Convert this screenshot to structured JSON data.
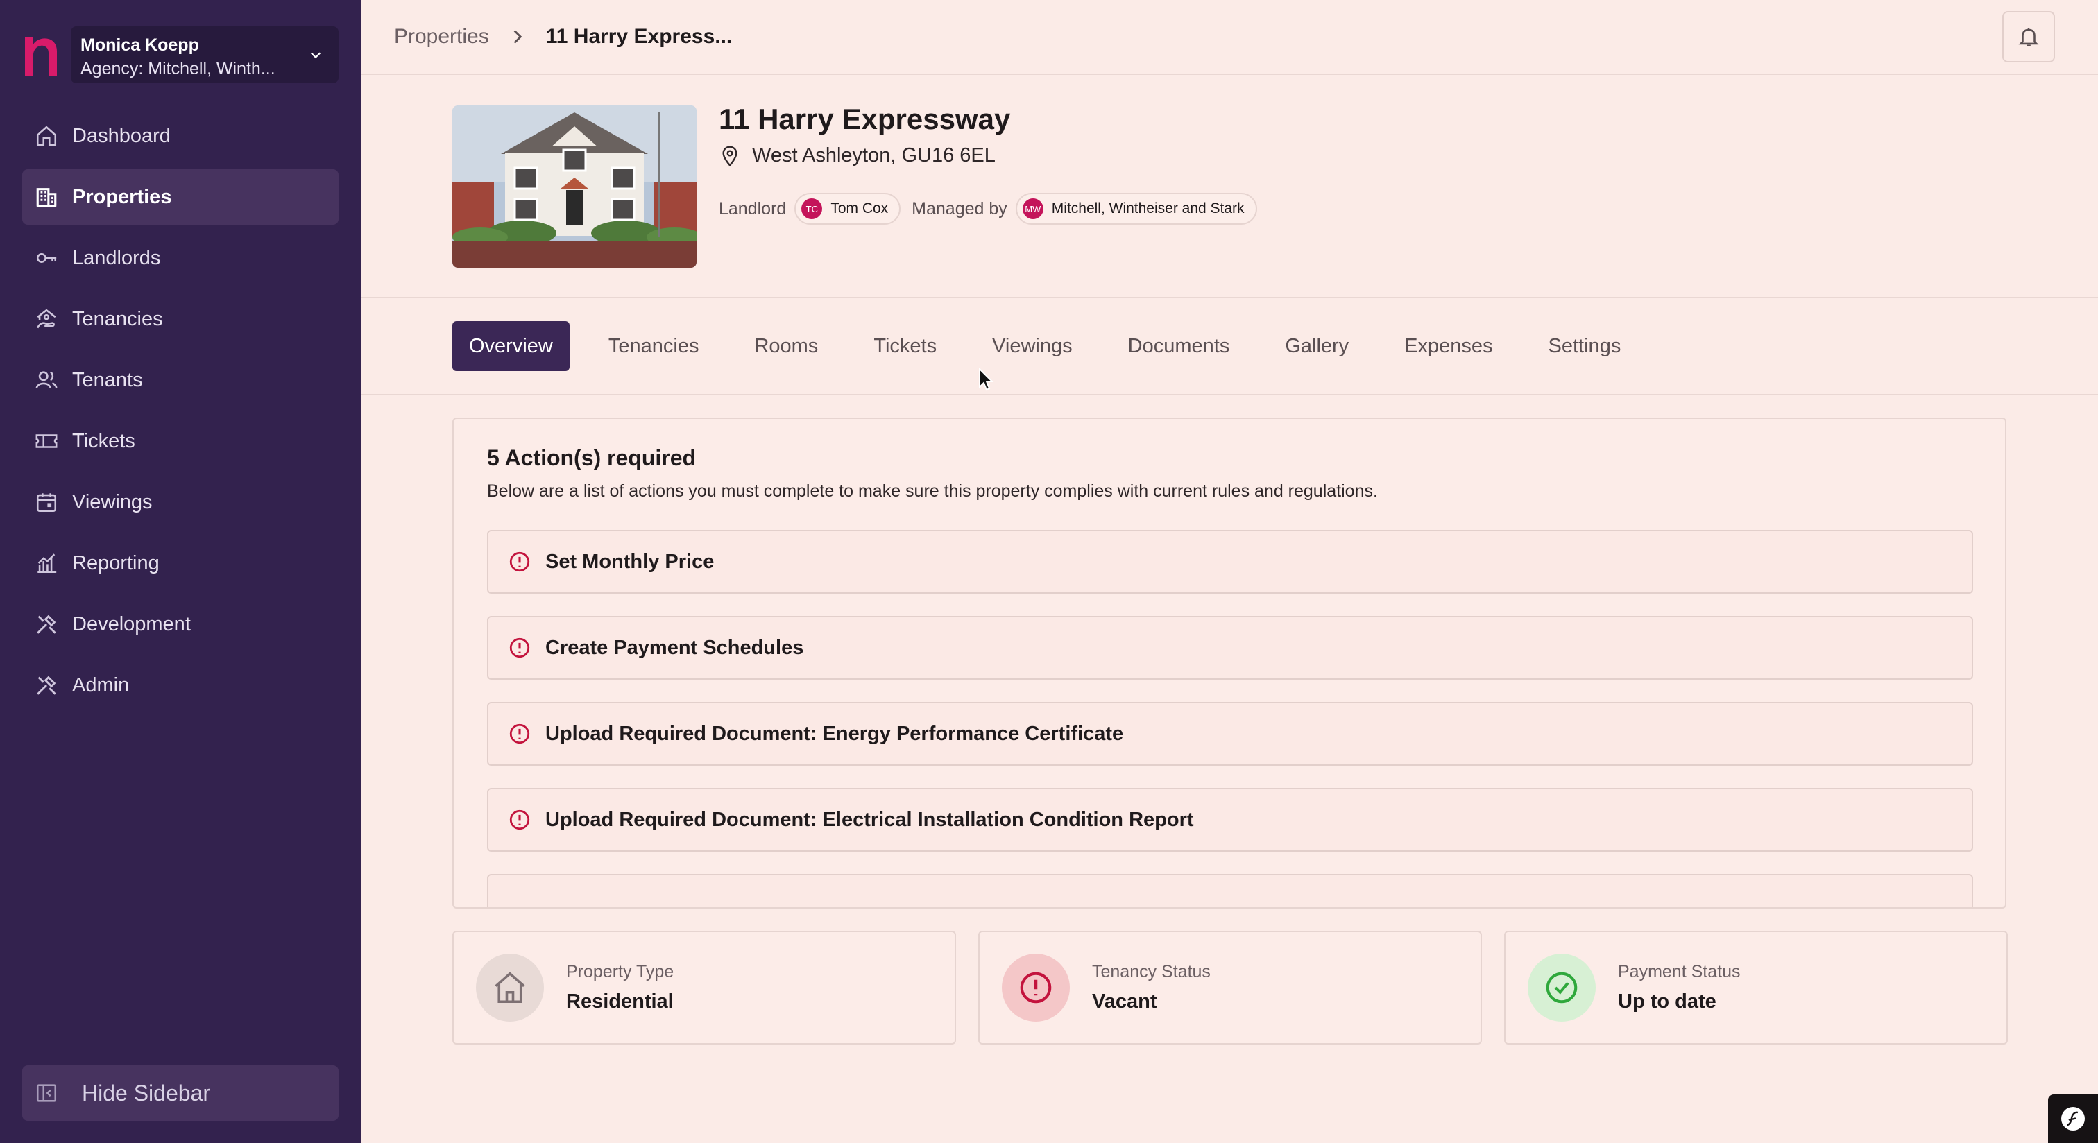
{
  "account": {
    "name": "Monica Koepp",
    "agency": "Agency: Mitchell, Winth..."
  },
  "nav": [
    {
      "label": "Dashboard",
      "icon": "home-icon",
      "active": false
    },
    {
      "label": "Properties",
      "icon": "building-icon",
      "active": true
    },
    {
      "label": "Landlords",
      "icon": "key-icon",
      "active": false
    },
    {
      "label": "Tenancies",
      "icon": "house-person-icon",
      "active": false
    },
    {
      "label": "Tenants",
      "icon": "users-icon",
      "active": false
    },
    {
      "label": "Tickets",
      "icon": "ticket-icon",
      "active": false
    },
    {
      "label": "Viewings",
      "icon": "calendar-icon",
      "active": false
    },
    {
      "label": "Reporting",
      "icon": "chart-icon",
      "active": false
    },
    {
      "label": "Development",
      "icon": "tools-icon",
      "active": false
    },
    {
      "label": "Admin",
      "icon": "tools-icon",
      "active": false
    }
  ],
  "hide_sidebar": "Hide Sidebar",
  "breadcrumb": {
    "parent": "Properties",
    "current": "11 Harry Express..."
  },
  "property": {
    "title": "11 Harry Expressway",
    "address": "West Ashleyton, GU16 6EL",
    "landlord_label": "Landlord",
    "landlord_initials": "TC",
    "landlord_name": "Tom Cox",
    "managed_label": "Managed by",
    "manager_initials": "MW",
    "manager_name": "Mitchell, Wintheiser and Stark"
  },
  "tabs": [
    "Overview",
    "Tenancies",
    "Rooms",
    "Tickets",
    "Viewings",
    "Documents",
    "Gallery",
    "Expenses",
    "Settings"
  ],
  "actions": {
    "title": "5 Action(s) required",
    "description": "Below are a list of actions you must complete to make sure this property complies with current rules and regulations.",
    "items": [
      "Set Monthly Price",
      "Create Payment Schedules",
      "Upload Required Document: Energy Performance Certificate",
      "Upload Required Document: Electrical Installation Condition Report"
    ]
  },
  "stats": [
    {
      "label": "Property Type",
      "value": "Residential",
      "icon": "house-icon",
      "color": "#e8dad6"
    },
    {
      "label": "Tenancy Status",
      "value": "Vacant",
      "icon": "alert-circle-icon",
      "color": "#f4c7c8"
    },
    {
      "label": "Payment Status",
      "value": "Up to date",
      "icon": "check-circle-icon",
      "color": "#d7f0d4"
    }
  ],
  "colors": {
    "sidebar": "#33224e",
    "accent": "#c4145a",
    "active_tab": "#3b2756",
    "background": "#fbebe7"
  }
}
